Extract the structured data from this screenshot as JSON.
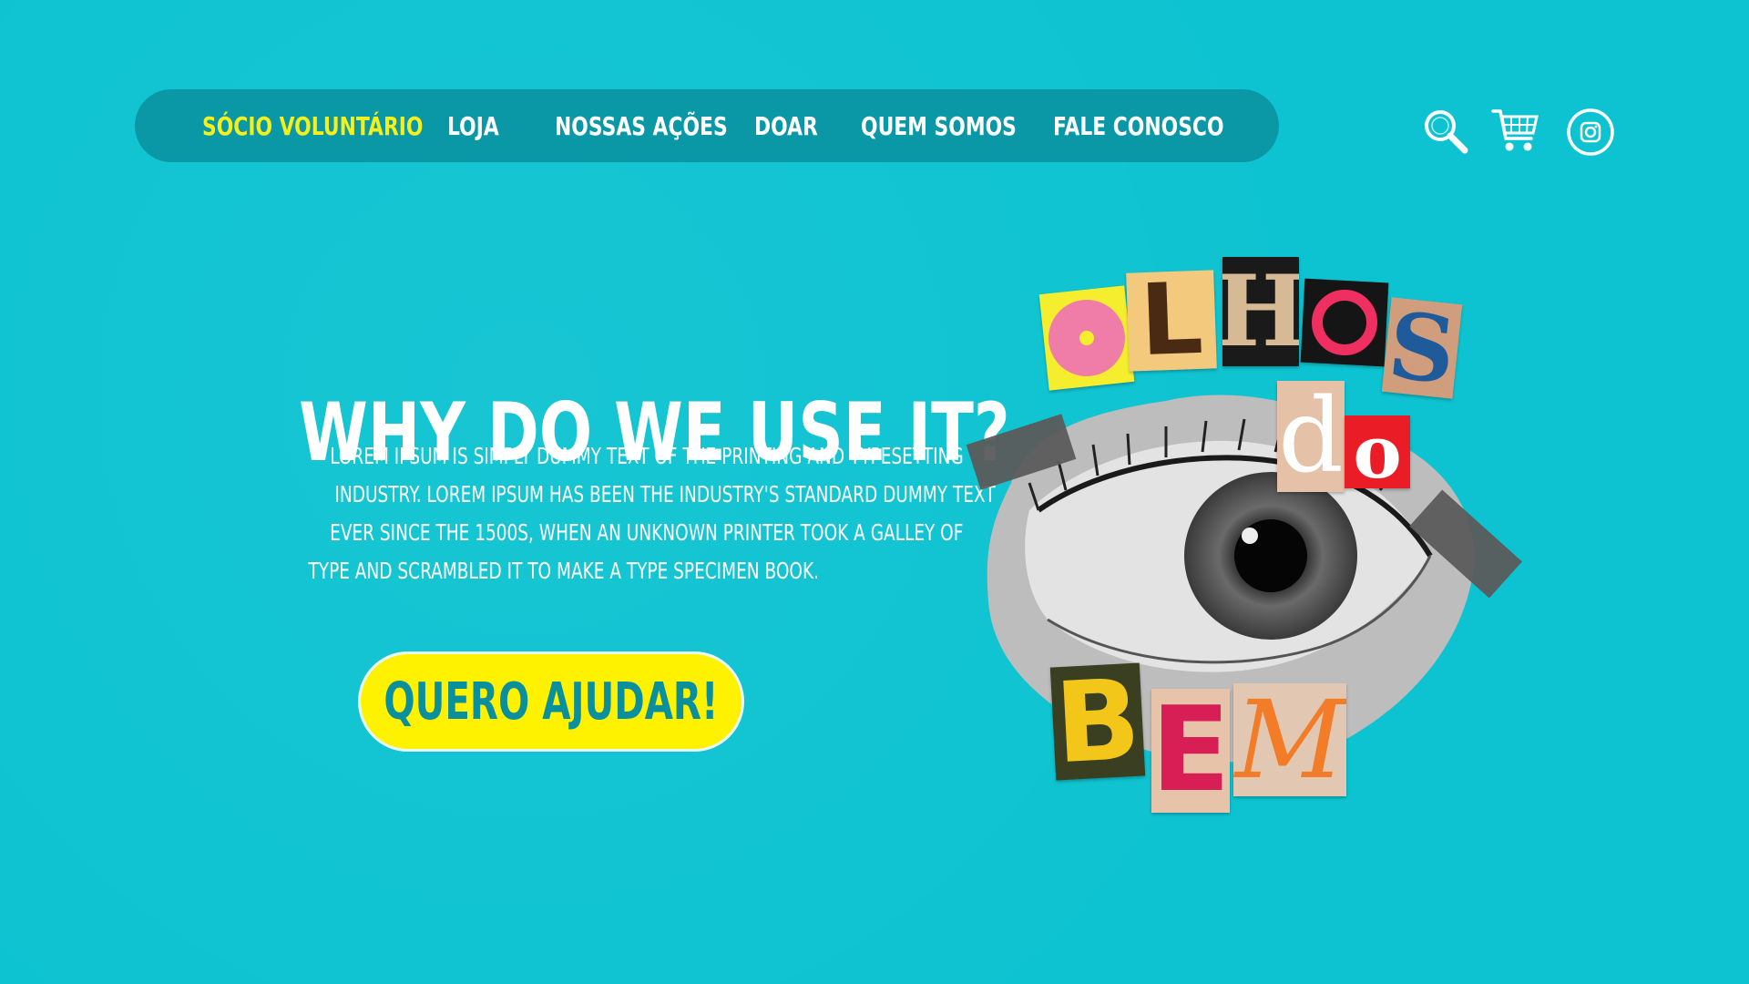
{
  "nav": {
    "items": [
      {
        "label": "SÓCIO VOLUNTÁRIO",
        "active": true
      },
      {
        "label": "LOJA",
        "active": false
      },
      {
        "label": "NOSSAS AÇÕES",
        "active": false
      },
      {
        "label": "DOAR",
        "active": false
      },
      {
        "label": "QUEM SOMOS",
        "active": false
      },
      {
        "label": "FALE CONOSCO",
        "active": false
      }
    ],
    "active_color": "#f5ef1c",
    "bar_color": "#0a98a6"
  },
  "header_icons": [
    {
      "name": "search-icon"
    },
    {
      "name": "cart-icon"
    },
    {
      "name": "instagram-icon"
    }
  ],
  "hero": {
    "title": "WHY DO WE USE IT?",
    "body_lines": [
      "Lorem Ipsum is simply dummy text of the printing and typesetting",
      "industry. Lorem Ipsum has been the industry's standard dummy text",
      "ever since the 1500s, when an unknown printer took a galley of",
      "type and scrambled it to make a type specimen book."
    ],
    "cta_label": "QUERO AJUDAR!"
  },
  "collage": {
    "letters": {
      "l": "L",
      "h": "H",
      "s": "S",
      "d": "d",
      "o3": "o",
      "b": "B",
      "e": "E",
      "m": "M"
    }
  },
  "colors": {
    "background": "#0ec3d1",
    "cta": "#fff200",
    "cta_text": "#0a8f9c"
  }
}
